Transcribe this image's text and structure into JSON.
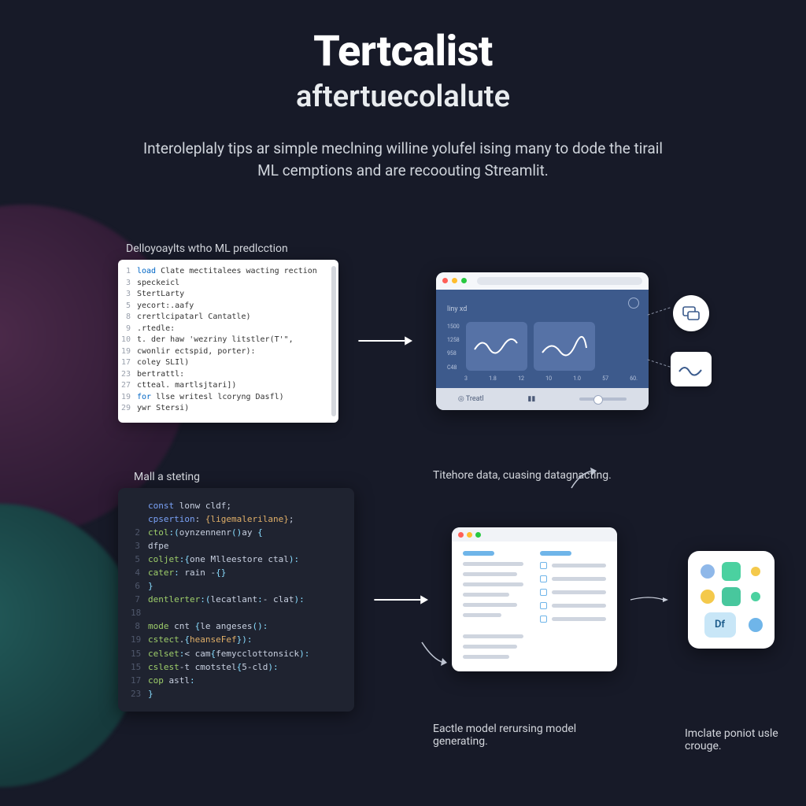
{
  "hero": {
    "title": "Tertcalist",
    "subtitle": "aftertuecolalute",
    "desc": "Interoleplaly tips ar simple meclning willine yolufel ising many to dode the tirail ML cemptions and are recoouting Streamlit."
  },
  "row1": {
    "label": "Delloyoaylts wtho ML predlcction",
    "code": {
      "lines": [
        {
          "n": "1",
          "t": "load Clate mectitalees wacting rection"
        },
        {
          "n": "3",
          "t": "speckeicl"
        },
        {
          "n": "3",
          "t": "StertLarty"
        },
        {
          "n": "5",
          "t": "yecort:.aafy"
        },
        {
          "n": "8",
          "t": "  crertlcipatarl Cantatle)"
        },
        {
          "n": "9",
          "t": "  .rtedle:"
        },
        {
          "n": "10",
          "t": "    t. der haw 'wezriny litstler(T'\","
        },
        {
          "n": "19",
          "t": "  cwonlir ectspid, porter):"
        },
        {
          "n": "17",
          "t": "  coley SLIl)"
        },
        {
          "n": "23",
          "t": "  bertrattl:"
        },
        {
          "n": "27",
          "t": "ctteal. martlsjtari])"
        },
        {
          "n": "19",
          "t": "for llse writesl lcoryng Dasfl)"
        },
        {
          "n": "29",
          "t": "ywr Stersi)"
        }
      ]
    },
    "browser": {
      "title": "liny xd",
      "yticks": [
        "1500",
        "1258",
        "958",
        "C48"
      ],
      "xticks": [
        "3",
        "1.8",
        "12",
        "10",
        "1.0",
        "57",
        "60."
      ],
      "footer_label": "Treatl"
    },
    "callouts": {
      "bubble_icon": "chat-window-icon",
      "tile_icon": "wave-icon"
    }
  },
  "row2": {
    "left_label": "Mall a steting",
    "mid_label": "Titehore data, cuasing datagnacting.",
    "bot_label": "Eactle model rerursing model generating.",
    "right_label": "Imclate poniot usle crouge.",
    "code": {
      "pre": [
        "const lonw cldf;",
        "cpsertion: {ligemalerilane};"
      ],
      "lines": [
        {
          "n": "2",
          "t": "ctol:(oynzennenr()ay {"
        },
        {
          "n": "3",
          "t": "    dfpe"
        },
        {
          "n": "5",
          "t": "    coljet:{one Mlleestore ctal):"
        },
        {
          "n": "4",
          "t": "    cater: rain -{}"
        },
        {
          "n": "6",
          "t": "}"
        },
        {
          "n": "7",
          "t": "dentlerter:(lecatlant:- clat):"
        },
        {
          "n": "18",
          "t": ""
        },
        {
          "n": "8",
          "t": "mode cnt {le angeses():"
        },
        {
          "n": "19",
          "t": "    cstect.{heanseFef}):"
        },
        {
          "n": "15",
          "t": "    celset:< cam{femycclottonsick):"
        },
        {
          "n": "15",
          "t": "    cslest-t cmotstel{5-cld):"
        },
        {
          "n": "17",
          "t": "    cop astl:"
        },
        {
          "n": "23",
          "t": "}"
        }
      ]
    },
    "cluster": {
      "df_label": "Df"
    }
  }
}
